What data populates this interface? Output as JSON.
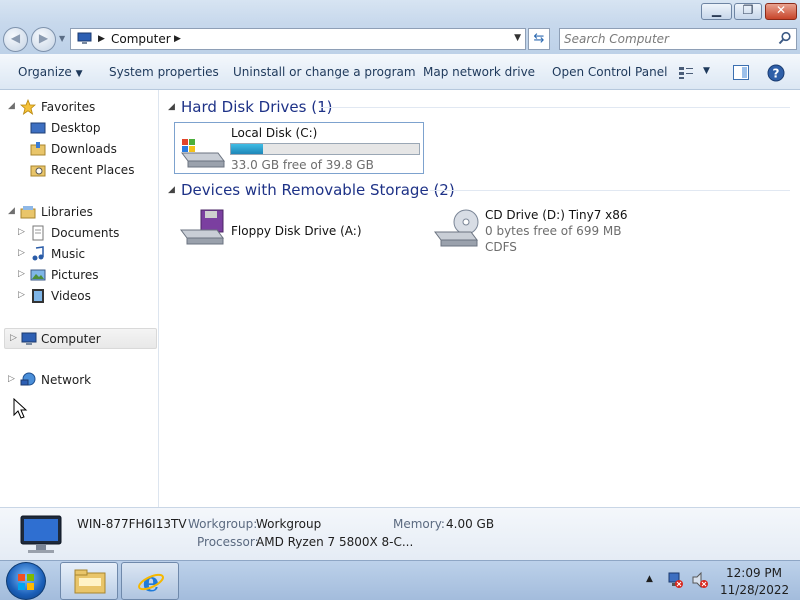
{
  "window": {
    "min_glyph": "▁",
    "max_glyph": "❐",
    "close_glyph": "✕"
  },
  "address": {
    "crumb": "Computer",
    "search_placeholder": "Search Computer"
  },
  "toolbar": {
    "organize": "Organize",
    "system_properties": "System properties",
    "uninstall": "Uninstall or change a program",
    "map_network": "Map network drive",
    "open_control_panel": "Open Control Panel"
  },
  "nav": {
    "favorites": "Favorites",
    "desktop": "Desktop",
    "downloads": "Downloads",
    "recent_places": "Recent Places",
    "libraries": "Libraries",
    "documents": "Documents",
    "music": "Music",
    "pictures": "Pictures",
    "videos": "Videos",
    "computer": "Computer",
    "network": "Network"
  },
  "groups": {
    "hdd_header": "Hard Disk Drives (1)",
    "removable_header": "Devices with Removable Storage (2)"
  },
  "drives": {
    "local_name": "Local Disk (C:)",
    "local_free": "33.0 GB free of 39.8 GB",
    "local_used_fraction": 0.17,
    "floppy_name": "Floppy Disk Drive (A:)",
    "cd_name": "CD Drive (D:) Tiny7 x86",
    "cd_free": "0 bytes free of 699 MB",
    "cd_fs": "CDFS"
  },
  "details": {
    "computer_name": "WIN-877FH6I13TV",
    "workgroup_label": "Workgroup:",
    "workgroup_value": "Workgroup",
    "memory_label": "Memory:",
    "memory_value": "4.00 GB",
    "processor_label": "Processor:",
    "processor_value": "AMD Ryzen 7 5800X 8-C..."
  },
  "taskbar": {
    "time": "12:09 PM",
    "date": "11/28/2022"
  },
  "colors": {
    "group_header": "#1e3287",
    "usage_bar": "#26a0da"
  }
}
